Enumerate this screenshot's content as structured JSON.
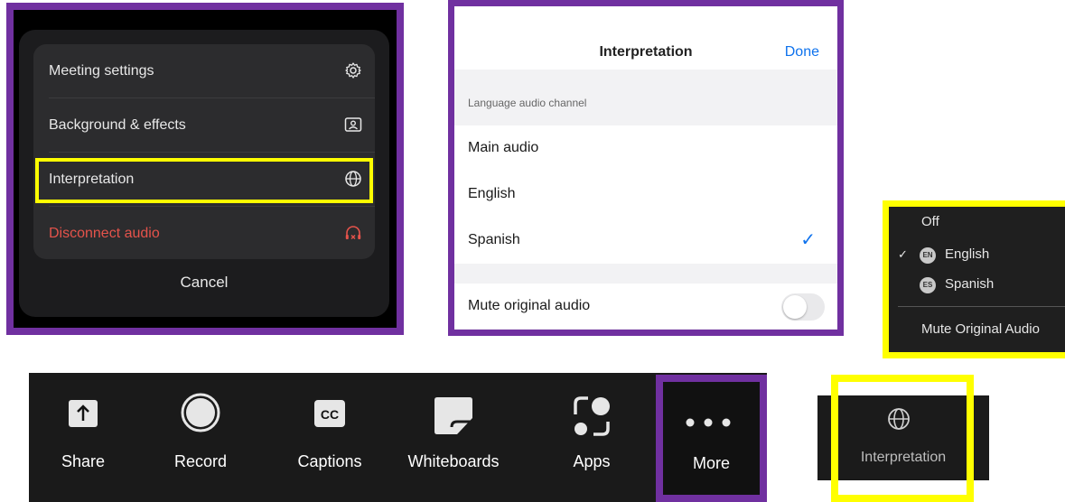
{
  "action_sheet": {
    "items": [
      {
        "label": "Meeting settings",
        "icon": "gear-icon"
      },
      {
        "label": "Background & effects",
        "icon": "portrait-frame-icon"
      },
      {
        "label": "Interpretation",
        "icon": "globe-icon"
      },
      {
        "label": "Disconnect audio",
        "icon": "disconnect-headphones-icon"
      }
    ],
    "cancel_label": "Cancel",
    "danger_color": "#e5534b"
  },
  "interpretation_settings": {
    "title": "Interpretation",
    "done_label": "Done",
    "section_header": "Language audio channel",
    "options": [
      {
        "label": "Main audio",
        "selected": false
      },
      {
        "label": "English",
        "selected": false
      },
      {
        "label": "Spanish",
        "selected": true
      }
    ],
    "mute_label": "Mute original audio",
    "mute_on": false,
    "accent_color": "#0e72ed"
  },
  "dropdown": {
    "off_label": "Off",
    "languages": [
      {
        "code": "EN",
        "label": "English",
        "checked": true
      },
      {
        "code": "ES",
        "label": "Spanish",
        "checked": false
      }
    ],
    "mute_label": "Mute Original Audio"
  },
  "toolbar": {
    "buttons": [
      {
        "label": "Share",
        "icon": "share-arrow-icon"
      },
      {
        "label": "Record",
        "icon": "record-circle-icon"
      },
      {
        "label": "Captions",
        "icon": "cc-icon"
      },
      {
        "label": "Whiteboards",
        "icon": "whiteboard-icon"
      },
      {
        "label": "Apps",
        "icon": "apps-icon"
      },
      {
        "label": "More",
        "icon": "more-dots-icon"
      }
    ]
  },
  "interpretation_button": {
    "label": "Interpretation",
    "icon": "globe-icon"
  },
  "highlight_colors": {
    "purple": "#7030a0",
    "yellow": "#ffff00"
  }
}
